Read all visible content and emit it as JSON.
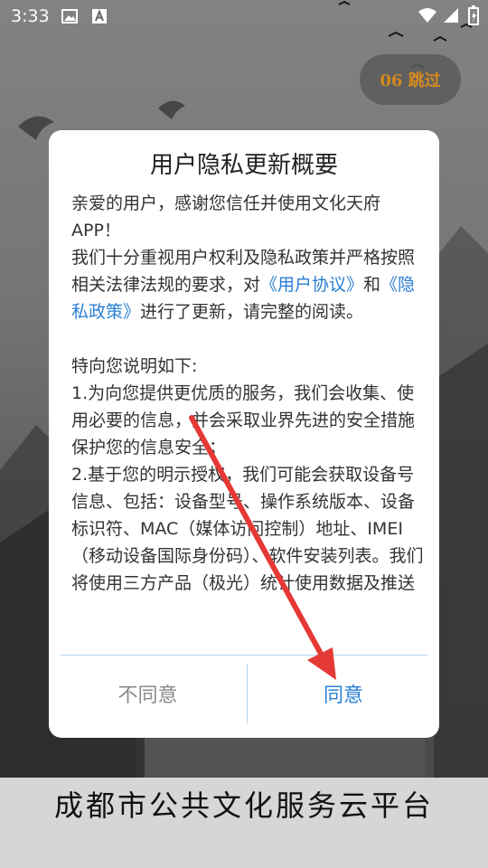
{
  "status_bar": {
    "time": "3:33"
  },
  "skip_button": {
    "label": "06 跳过"
  },
  "dialog": {
    "title": "用户隐私更新概要",
    "greeting": " 亲爱的用户，感谢您信任并使用文化天府APP！",
    "intro_before": "我们十分重视用户权利及隐私政策并严格按照相关法律法规的要求，对",
    "link_agreement": "《用户协议》",
    "intro_and": "和",
    "link_privacy": "《隐私政策》",
    "intro_after": "进行了更新，请完整的阅读。",
    "statement_heading": "特向您说明如下:",
    "point1": "1.为向您提供更优质的服务，我们会收集、使用必要的信息，并会采取业界先进的安全措施保护您的信息安全；",
    "point2": "2.基于您的明示授权，我们可能会获取设备号信息、包括：设备型号、操作系统版本、设备标识符、MAC（媒体访问控制）地址、IMEI（移动设备国际身份码）、软件安装列表。我们将使用三方产品（极光）统计使用数据及推送",
    "disagree_label": "不同意",
    "agree_label": "同意"
  },
  "footer": {
    "title": "成都市公共文化服务云平台"
  },
  "colors": {
    "link": "#2a7fd4",
    "skip_text": "#d38a1e",
    "arrow": "#e53935"
  }
}
